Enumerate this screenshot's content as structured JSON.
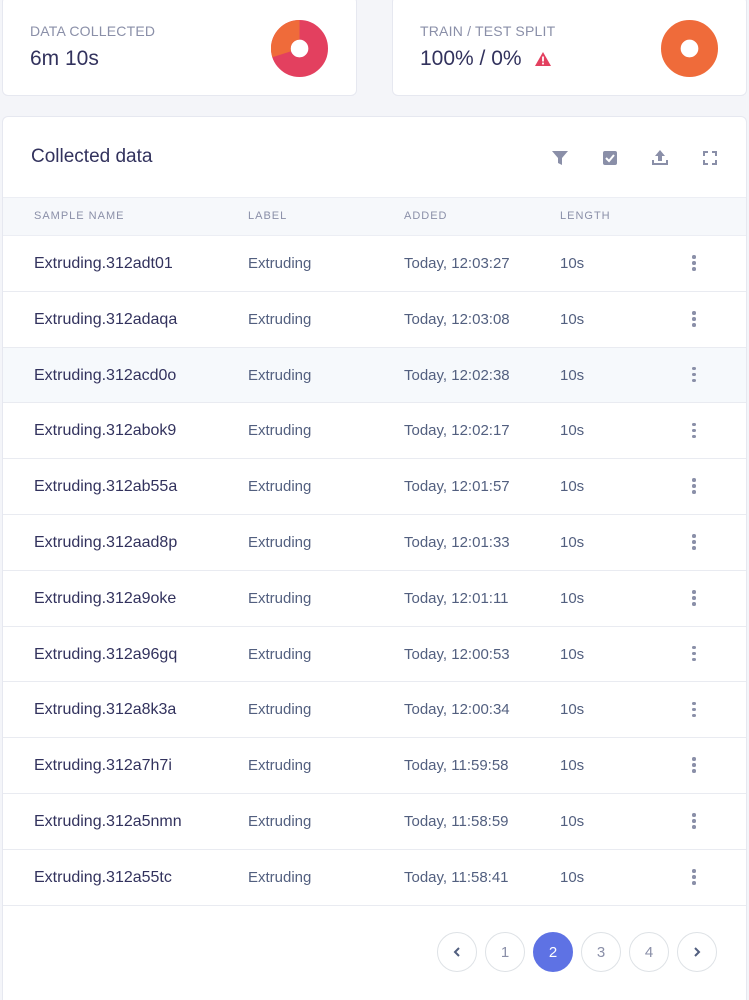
{
  "stats": {
    "data_collected": {
      "label": "DATA COLLECTED",
      "value": "6m 10s",
      "donut_colors": [
        "#e3405f",
        "#ef6b3a"
      ],
      "donut_fraction_primary": 0.7
    },
    "train_test_split": {
      "label": "TRAIN / TEST SPLIT",
      "value": "100% / 0%",
      "warning_icon": "warning-triangle-icon",
      "donut_color": "#ef6b3a"
    }
  },
  "table": {
    "title": "Collected data",
    "toolbar_icons": [
      "filter-icon",
      "select-checkbox-icon",
      "upload-icon",
      "expand-icon"
    ],
    "columns": [
      "SAMPLE NAME",
      "LABEL",
      "ADDED",
      "LENGTH"
    ],
    "rows": [
      {
        "name": "Extruding.312adt01",
        "label": "Extruding",
        "added": "Today, 12:03:27",
        "length": "10s"
      },
      {
        "name": "Extruding.312adaqa",
        "label": "Extruding",
        "added": "Today, 12:03:08",
        "length": "10s"
      },
      {
        "name": "Extruding.312acd0o",
        "label": "Extruding",
        "added": "Today, 12:02:38",
        "length": "10s"
      },
      {
        "name": "Extruding.312abok9",
        "label": "Extruding",
        "added": "Today, 12:02:17",
        "length": "10s"
      },
      {
        "name": "Extruding.312ab55a",
        "label": "Extruding",
        "added": "Today, 12:01:57",
        "length": "10s"
      },
      {
        "name": "Extruding.312aad8p",
        "label": "Extruding",
        "added": "Today, 12:01:33",
        "length": "10s"
      },
      {
        "name": "Extruding.312a9oke",
        "label": "Extruding",
        "added": "Today, 12:01:11",
        "length": "10s"
      },
      {
        "name": "Extruding.312a96gq",
        "label": "Extruding",
        "added": "Today, 12:00:53",
        "length": "10s"
      },
      {
        "name": "Extruding.312a8k3a",
        "label": "Extruding",
        "added": "Today, 12:00:34",
        "length": "10s"
      },
      {
        "name": "Extruding.312a7h7i",
        "label": "Extruding",
        "added": "Today, 11:59:58",
        "length": "10s"
      },
      {
        "name": "Extruding.312a5nmn",
        "label": "Extruding",
        "added": "Today, 11:58:59",
        "length": "10s"
      },
      {
        "name": "Extruding.312a55tc",
        "label": "Extruding",
        "added": "Today, 11:58:41",
        "length": "10s"
      }
    ],
    "hovered_row_index": 2
  },
  "pagination": {
    "pages": [
      "1",
      "2",
      "3",
      "4"
    ],
    "current": "2",
    "accent_color": "#5e72e4"
  }
}
